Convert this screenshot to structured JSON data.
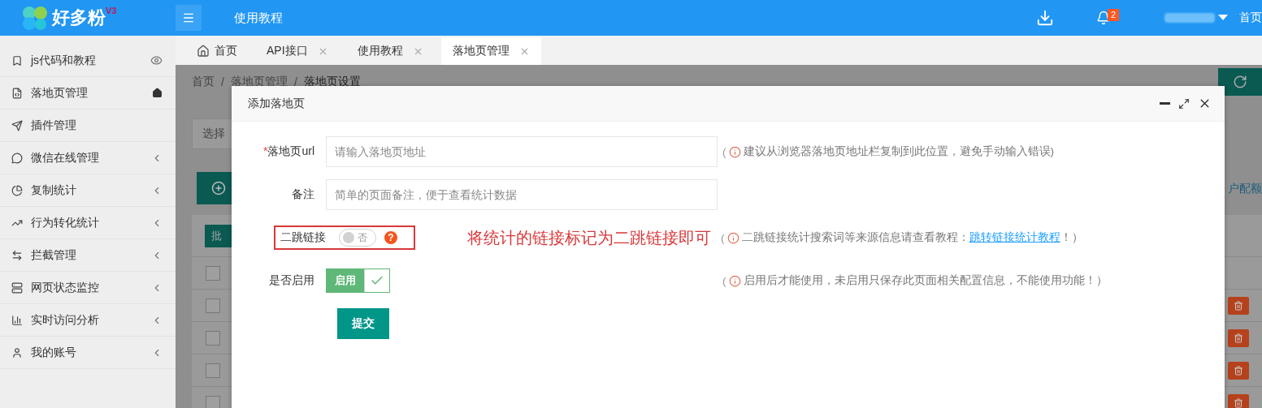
{
  "header": {
    "logo": "好多粉",
    "version": "V3",
    "title": "使用教程",
    "notifications": "2",
    "right_link": "首页"
  },
  "sidebar": {
    "items": [
      {
        "label": "js代码和教程",
        "kind": "eye",
        "selected": false
      },
      {
        "label": "落地页管理",
        "kind": "home",
        "selected": false
      },
      {
        "label": "插件管理",
        "kind": "plain",
        "selected": false
      },
      {
        "label": "微信在线管理",
        "kind": "submenu",
        "selected": false
      },
      {
        "label": "复制统计",
        "kind": "submenu",
        "selected": false
      },
      {
        "label": "行为转化统计",
        "kind": "submenu",
        "selected": false
      },
      {
        "label": "拦截管理",
        "kind": "submenu",
        "selected": false
      },
      {
        "label": "网页状态监控",
        "kind": "submenu",
        "selected": false
      },
      {
        "label": "实时访问分析",
        "kind": "submenu",
        "selected": false
      },
      {
        "label": "我的账号",
        "kind": "submenu",
        "selected": false
      }
    ]
  },
  "tabs": [
    {
      "label": "首页",
      "kind": "home",
      "selected": false
    },
    {
      "label": "API接口",
      "kind": "page",
      "selected": false
    },
    {
      "label": "使用教程",
      "kind": "page",
      "selected": false
    },
    {
      "label": "落地页管理",
      "kind": "page",
      "selected": true
    }
  ],
  "page": {
    "breadcrumb": [
      "首页",
      "/",
      "落地页管理",
      "/",
      "落地页设置"
    ],
    "select_placeholder": "选择",
    "batch_button": "批",
    "quota_text": "户配额",
    "header_checked": false,
    "rows": [
      {
        "checked": false
      },
      {
        "checked": false
      },
      {
        "checked": false
      },
      {
        "checked": false
      }
    ]
  },
  "dialog": {
    "title": "添加落地页",
    "fields": [
      {
        "kind": "input",
        "label": "落地页url",
        "required_mark": "*",
        "placeholder": "请输入落地页地址",
        "hint": {
          "prefix": "(",
          "text": "建议从浏览器落地页地址栏复制到此位置，避免手动输入错误)"
        }
      },
      {
        "kind": "input",
        "label": "备注",
        "placeholder": "简单的页面备注，便于查看统计数据"
      },
      {
        "kind": "switch",
        "label": "二跳链接",
        "on": false,
        "text": "否",
        "help": "?",
        "highlighted": true,
        "hint": {
          "prefix": "(",
          "text": "二跳链接统计搜索词等来源信息请查看教程：",
          "link": "跳转链接统计教程",
          "suffix": "！）"
        }
      },
      {
        "kind": "checkswitch",
        "label": "是否启用",
        "on": true,
        "text": "启用",
        "hint": {
          "prefix": "(",
          "text": "启用后才能使用，未启用只保存此页面相关配置信息，不能使用功能！）"
        }
      }
    ],
    "submit": "提交",
    "annotation": "将统计的链接标记为二跳链接即可"
  }
}
